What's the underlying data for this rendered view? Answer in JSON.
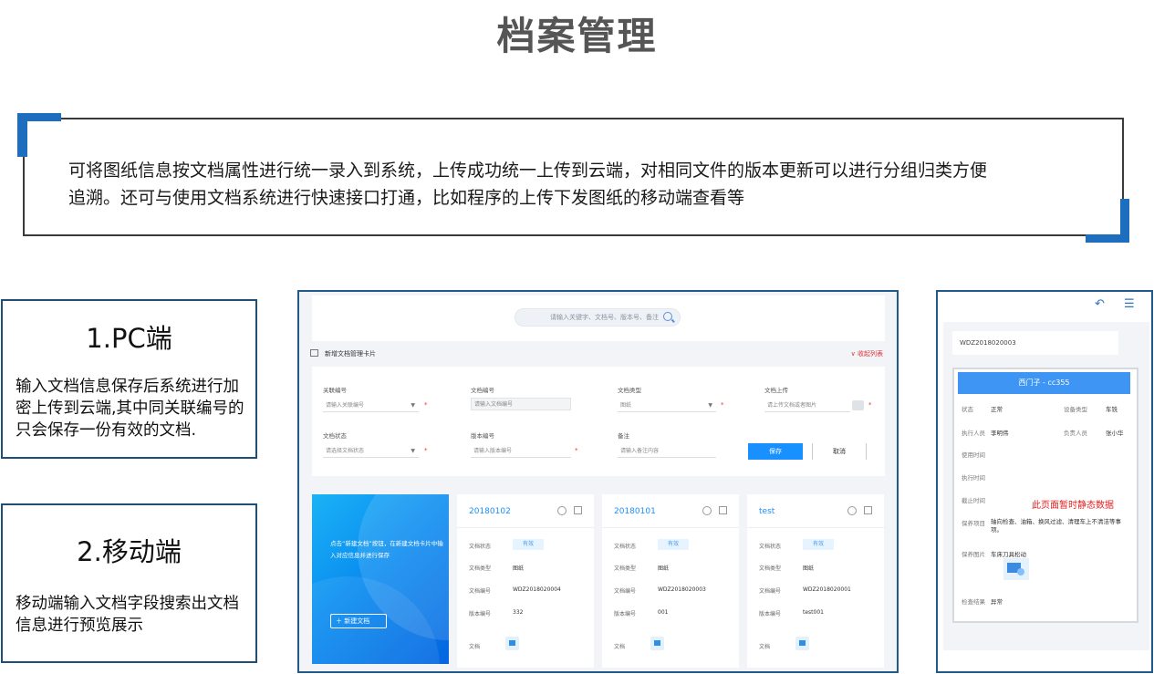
{
  "title": "档案管理",
  "description": {
    "line1": "可将图纸信息按文档属性进行统一录入到系统，上传成功统一上传到云端，对相同文件的版本更新可以进行分组归类方便",
    "line2": "追溯。还可与使用文档系统进行快速接口打通，比如程序的上传下发图纸的移动端查看等"
  },
  "pc_box": {
    "title": "1.PC端",
    "body": "输入文档信息保存后系统进行加密上传到云端,其中同关联编号的只会保存一份有效的文档."
  },
  "mobile_box": {
    "title": "2.移动端",
    "body": "移动端输入文档字段搜索出文档信息进行预览展示"
  },
  "pc_screen": {
    "search_placeholder": "请输入关键字、文档号、版本号、备注",
    "section_title": "新增文档管理卡片",
    "collapse_label": "∨ 收起列表",
    "form": {
      "field1_label": "关联编号",
      "field1_placeholder": "请输入关联编号",
      "field2_label": "文档编号",
      "field2_placeholder": "请输入文档编号",
      "field3_label": "文档类型",
      "field3_value": "图纸",
      "field4_label": "文档上传",
      "field4_placeholder": "请上传文档或者图片",
      "field5_label": "文档状态",
      "field5_placeholder": "请选择文档状态",
      "field6_label": "版本编号",
      "field6_placeholder": "请输入版本编号",
      "field7_label": "备注",
      "field7_placeholder": "请输入备注内容",
      "save_label": "保存",
      "cancel_label": "取消"
    },
    "new_card": {
      "text": "点击“新建文档”按钮，在新建文档卡片中输入对应信息并进行保存",
      "button_label": "＋ 新建文档"
    },
    "cards": [
      {
        "title": "20180102",
        "status_key": "文档状态",
        "status": "有效",
        "type_key": "文档类型",
        "type": "图纸",
        "code_key": "文档编号",
        "code": "WDZ2018020004",
        "version_key": "版本编号",
        "version": "332",
        "file_key": "文档"
      },
      {
        "title": "20180101",
        "status_key": "文档状态",
        "status": "有效",
        "type_key": "文档类型",
        "type": "图纸",
        "code_key": "文档编号",
        "code": "WDZ2018020003",
        "version_key": "版本编号",
        "version": "001",
        "file_key": "文档"
      },
      {
        "title": "test",
        "status_key": "文档状态",
        "status": "有效",
        "type_key": "文档类型",
        "type": "图纸",
        "code_key": "文档编号",
        "code": "WDZ2018020001",
        "version_key": "版本编号",
        "version": "test001",
        "file_key": "文档"
      }
    ]
  },
  "mobile_screen": {
    "back_icon": "↶",
    "menu_icon": "☰",
    "doc_title": "WDZ2018020003",
    "card_head": "西门子 - cc355",
    "rows": {
      "r1_k": "状态",
      "r1_v": "正常",
      "r1_k2": "设备类型",
      "r1_v2": "车铣",
      "r2_k": "执行人员",
      "r2_v": "李明伟",
      "r2_k2": "负责人员",
      "r2_v2": "张小华",
      "r3_k": "使用时间",
      "r4_k": "执行时间",
      "r5_k": "截止时间",
      "r6_k": "保养项目",
      "r6_v": "轴向检查、油箱、换风过滤、清理车上不清洁等事项。",
      "r7_k": "保养图片",
      "r7_v": "车床刀具松动",
      "r8_k": "检查结果",
      "r8_v": "异常"
    },
    "note": "此页面暂时静态数据"
  }
}
